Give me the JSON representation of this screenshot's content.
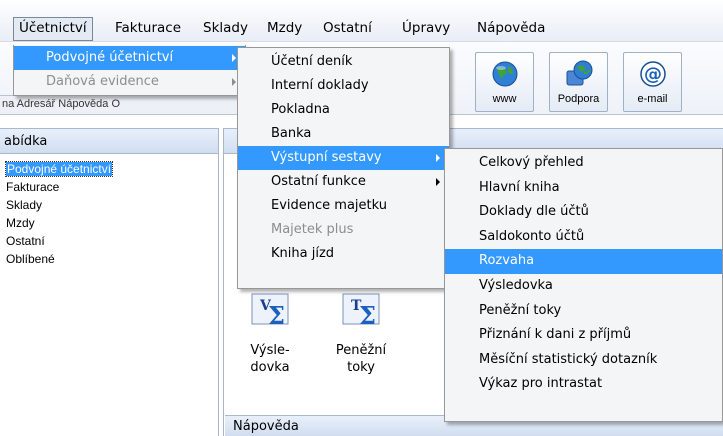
{
  "menubar": {
    "items": [
      "Účetnictví",
      "Fakturace",
      "Sklady",
      "Mzdy",
      "Ostatní",
      "Úpravy",
      "Nápověda"
    ]
  },
  "toolbar": {
    "buttons": [
      {
        "label": "www",
        "icon": "globe-icon"
      },
      {
        "label": "Podpora",
        "icon": "support-globe-icon"
      },
      {
        "label": "e-mail",
        "icon": "at-sign-icon"
      }
    ],
    "hidden_strip": "na   Adresář   Nápověda   O"
  },
  "leftpanel": {
    "title": "abídka",
    "items": [
      "Podvojné účetnictví",
      "Fakturace",
      "Sklady",
      "Mzdy",
      "Ostatní",
      "Oblíbené"
    ]
  },
  "mainpanel": {
    "icons": [
      {
        "label1": "Výsle-",
        "label2": "dovka",
        "icon": "sigma-v-icon"
      },
      {
        "label1": "Peněžní",
        "label2": "toky",
        "icon": "sigma-t-icon"
      }
    ],
    "help_title": "Nápověda"
  },
  "menu_ucetnictvi": {
    "items": [
      {
        "label": "Podvojné účetnictví",
        "state": "highlighted",
        "submenu": true
      },
      {
        "label": "Daňová evidence",
        "state": "disabled",
        "submenu": true
      }
    ]
  },
  "menu_podvojne": {
    "items": [
      {
        "label": "Účetní deník",
        "state": "normal"
      },
      {
        "label": "Interní doklady",
        "state": "normal"
      },
      {
        "label": "Pokladna",
        "state": "normal"
      },
      {
        "label": "Banka",
        "state": "normal"
      },
      {
        "label": "Výstupní sestavy",
        "state": "highlighted",
        "submenu": true
      },
      {
        "label": "Ostatní funkce",
        "state": "normal",
        "submenu": true
      },
      {
        "label": "Evidence majetku",
        "state": "normal"
      },
      {
        "label": "Majetek plus",
        "state": "disabled"
      },
      {
        "label": "Kniha jízd",
        "state": "normal"
      }
    ]
  },
  "menu_sestavy": {
    "items": [
      {
        "label": "Celkový přehled",
        "state": "normal"
      },
      {
        "label": "Hlavní kniha",
        "state": "normal"
      },
      {
        "label": "Doklady dle účtů",
        "state": "normal"
      },
      {
        "label": "Saldokonto účtů",
        "state": "normal"
      },
      {
        "label": "Rozvaha",
        "state": "highlighted"
      },
      {
        "label": "Výsledovka",
        "state": "normal"
      },
      {
        "label": "Peněžní toky",
        "state": "normal"
      },
      {
        "label": "Přiznání k dani z příjmů",
        "state": "normal"
      },
      {
        "label": "Měsíční statistický dotazník",
        "state": "normal"
      },
      {
        "label": "Výkaz pro intrastat",
        "state": "normal"
      }
    ]
  },
  "colors": {
    "highlight": "#3399ff",
    "menu_bg": "#f4f5f7",
    "disabled_text": "#8d8d8d",
    "panel_header": "#d1def0"
  }
}
